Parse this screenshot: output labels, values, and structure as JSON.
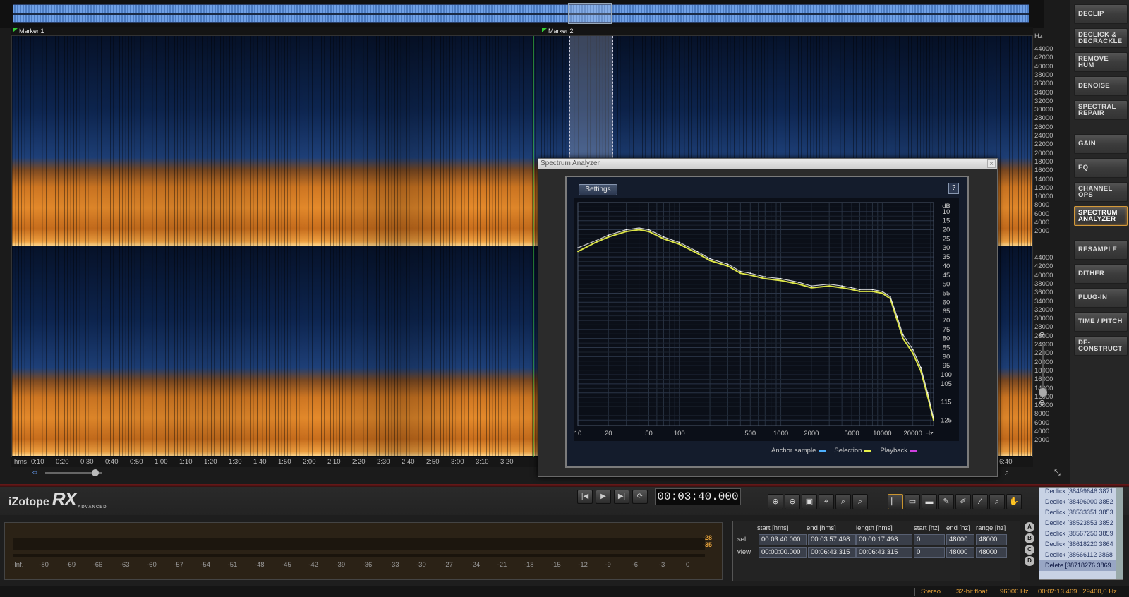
{
  "app": {
    "logo": "iZotope",
    "logo_rx": "RX",
    "logo_edition": "ADVANCED"
  },
  "markers": [
    {
      "label": "Marker 1"
    },
    {
      "label": "Marker 2"
    }
  ],
  "freq_axis": {
    "unit": "Hz",
    "ticks": [
      "44000",
      "42000",
      "40000",
      "38000",
      "36000",
      "34000",
      "32000",
      "30000",
      "28000",
      "26000",
      "24000",
      "22000",
      "20000",
      "18000",
      "16000",
      "14000",
      "12000",
      "10000",
      "8000",
      "6000",
      "4000",
      "2000"
    ]
  },
  "time_axis": {
    "unit": "hms",
    "ticks": [
      "0:10",
      "0:20",
      "0:30",
      "0:40",
      "0:50",
      "1:00",
      "1:10",
      "1:20",
      "1:30",
      "1:40",
      "1:50",
      "2:00",
      "2:10",
      "2:20",
      "2:30",
      "2:40",
      "2:50",
      "3:00",
      "3:10",
      "3:20"
    ],
    "end_tick": "6:40"
  },
  "modules": [
    {
      "label": "DECLIP"
    },
    {
      "label": "DECLICK & DECRACKLE"
    },
    {
      "label": "REMOVE HUM"
    },
    {
      "label": "DENOISE"
    },
    {
      "label": "SPECTRAL REPAIR"
    },
    {
      "label": "GAIN"
    },
    {
      "label": "EQ"
    },
    {
      "label": "CHANNEL OPS"
    },
    {
      "label": "SPECTRUM ANALYZER"
    },
    {
      "label": "RESAMPLE"
    },
    {
      "label": "DITHER"
    },
    {
      "label": "PLUG-IN"
    },
    {
      "label": "TIME / PITCH"
    },
    {
      "label": "DE-CONSTRUCT"
    }
  ],
  "active_module": "SPECTRUM ANALYZER",
  "spectrum_analyzer": {
    "title": "Spectrum Analyzer",
    "settings_label": "Settings",
    "help_label": "?",
    "close_label": "×",
    "db_unit": "dB",
    "hz_unit": "Hz",
    "x_labels": [
      "10",
      "20",
      "50",
      "100",
      "500",
      "1000",
      "2000",
      "5000",
      "10000",
      "20000"
    ],
    "y_labels": [
      "10",
      "15",
      "20",
      "25",
      "30",
      "35",
      "40",
      "45",
      "50",
      "55",
      "60",
      "65",
      "70",
      "75",
      "80",
      "85",
      "90",
      "95",
      "100",
      "105",
      "115",
      "125"
    ],
    "legend": [
      {
        "label": "Anchor sample",
        "color": "#4db0ff"
      },
      {
        "label": "Selection",
        "color": "#e8f04a"
      },
      {
        "label": "Playback",
        "color": "#d040e0"
      }
    ]
  },
  "chart_data": {
    "type": "line",
    "xscale": "log",
    "xlim": [
      10,
      32000
    ],
    "ylim": [
      5,
      128
    ],
    "yaxis": "inverted",
    "grid": true,
    "series": [
      {
        "name": "Selection",
        "color": "#e8f04a",
        "x": [
          10,
          15,
          20,
          30,
          40,
          50,
          70,
          100,
          150,
          200,
          300,
          400,
          500,
          700,
          1000,
          1500,
          2000,
          3000,
          4000,
          5000,
          6000,
          8000,
          10000,
          12000,
          14000,
          16000,
          20000,
          24000,
          28000,
          32000
        ],
        "y": [
          32,
          27,
          24,
          21,
          20,
          21,
          25,
          28,
          33,
          37,
          40,
          44,
          45,
          47,
          48,
          50,
          52,
          51,
          52,
          53,
          54,
          54,
          55,
          58,
          70,
          80,
          88,
          98,
          112,
          125
        ]
      },
      {
        "name": "Anchor sample",
        "color": "#ffffff",
        "x": [
          10,
          15,
          20,
          30,
          40,
          50,
          70,
          100,
          150,
          200,
          300,
          400,
          500,
          700,
          1000,
          1500,
          2000,
          3000,
          4000,
          5000,
          6000,
          8000,
          10000,
          12000,
          14000,
          16000,
          20000,
          24000,
          28000,
          32000
        ],
        "y": [
          30,
          26,
          23,
          20,
          19,
          20,
          24,
          27,
          32,
          36,
          39,
          43,
          44,
          46,
          47,
          49,
          51,
          50,
          51,
          52,
          53,
          53,
          54,
          57,
          68,
          78,
          86,
          96,
          110,
          124
        ]
      }
    ]
  },
  "transport": {
    "timecode": "00:03:40.000",
    "buttons": [
      "|◀",
      "▶",
      "▶|",
      "⟳"
    ]
  },
  "meter": {
    "peak_top": "-28",
    "peak_bottom": "-35",
    "scale": [
      "-Inf.",
      "-80",
      "-69",
      "-66",
      "-63",
      "-60",
      "-57",
      "-54",
      "-51",
      "-48",
      "-45",
      "-42",
      "-39",
      "-36",
      "-33",
      "-30",
      "-27",
      "-24",
      "-21",
      "-18",
      "-15",
      "-12",
      "-9",
      "-6",
      "-3",
      "0"
    ]
  },
  "selection_table": {
    "headers": [
      "start [hms]",
      "end [hms]",
      "length [hms]",
      "start [hz]",
      "end [hz]",
      "range [hz]"
    ],
    "rows": [
      {
        "label": "sel",
        "values": [
          "00:03:40.000",
          "00:03:57.498",
          "00:00:17.498",
          "0",
          "48000",
          "48000"
        ]
      },
      {
        "label": "view",
        "values": [
          "00:00:00.000",
          "00:06:43.315",
          "00:06:43.315",
          "0",
          "48000",
          "48000"
        ]
      }
    ]
  },
  "snapshots": [
    "A",
    "B",
    "C",
    "D"
  ],
  "history": [
    "Declick [38499646 3871",
    "Declick [38496000 3852",
    "Declick [38533351 3853",
    "Declick [38523853 3852",
    "Declick [38567250 3859",
    "Declick [38618220 3864",
    "Declick [38666112 3868",
    "Delete [38718276 3869"
  ],
  "status": {
    "channels": "Stereo",
    "bit_depth": "32-bit float",
    "sample_rate": "96000 Hz",
    "cursor": "00:02:13.469 | 29400,0 Hz"
  }
}
